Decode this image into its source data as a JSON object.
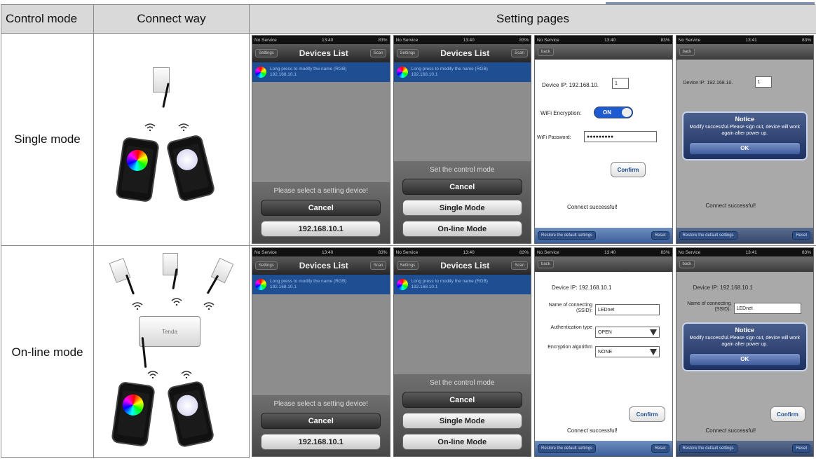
{
  "headers": {
    "control_mode": "Control mode",
    "connect_way": "Connect way",
    "setting_pages": "Setting pages"
  },
  "modes": {
    "single": "Single mode",
    "online": "On-line mode"
  },
  "router_brand": "Tenda",
  "common": {
    "no_service": "No Service",
    "battery": "83%",
    "settings_btn": "Settings",
    "scan_btn": "Scan",
    "back_btn": "back"
  },
  "devices_list": {
    "title": "Devices List",
    "device_name": "Long press to modify the name (RGB)",
    "device_ip": "192.168.10.1"
  },
  "select_sheet": {
    "prompt": "Please select a setting device!",
    "cancel": "Cancel",
    "ip_option": "192.168.10.1"
  },
  "control_sheet": {
    "prompt": "Set the control mode",
    "cancel": "Cancel",
    "single": "Single Mode",
    "online": "On-line Mode"
  },
  "single_settings": {
    "time": "13:40",
    "ip_label": "Device IP: 192.168.10.",
    "ip_last": "1",
    "enc_label": "WiFi Encryption:",
    "enc_state": "ON",
    "pwd_label": "WiFi Password:",
    "pwd_value": "●●●●●●●●●",
    "confirm": "Confirm",
    "success": "Connect successful!",
    "restore": "Restore the default settings",
    "reset": "Reset"
  },
  "single_notice": {
    "time": "13:41",
    "ip_label": "Device IP: 192.168.10.",
    "ip_last": "1",
    "title": "Notice",
    "message": "Modify successful.Please sign out, device will work again after power up.",
    "ok": "OK",
    "success": "Connect successful!",
    "restore": "Restore the default settings",
    "reset": "Reset"
  },
  "online_settings": {
    "time": "13:40",
    "ip_label": "Device IP: 192.168.10.1",
    "ssid_label": "Name of connecting (SSID):",
    "ssid_value": "LEDnet",
    "auth_label": "Authentication type",
    "auth_value": "OPEN",
    "algo_label": "Encryption algorithm",
    "algo_value": "NONE",
    "confirm": "Confirm",
    "success": "Connect successful!",
    "restore": "Restore the default settings",
    "reset": "Reset"
  },
  "online_notice": {
    "ip_label": "Device IP: 192.168.10.1",
    "ssid_label": "Name of connecting (SSID):",
    "ssid_value": "LEDnet",
    "title": "Notice",
    "message": "Modify successful.Please sign out, device will work again after power up.",
    "ok": "OK",
    "confirm": "Confirm",
    "success": "Connect successful!",
    "restore": "Restore the default settings",
    "reset": "Reset"
  },
  "colors": {
    "header_bg": "#d9d9d9",
    "ios_blue": "#1f4e92",
    "toolbar_blue": "#3a5e9a"
  }
}
